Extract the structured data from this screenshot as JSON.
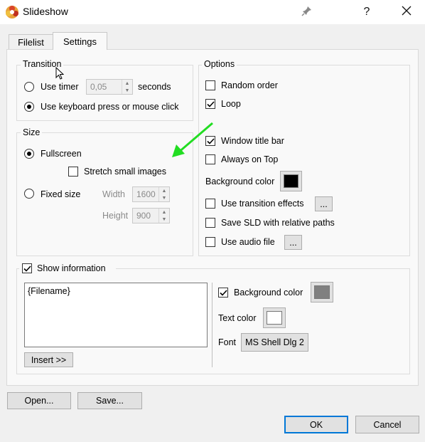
{
  "window": {
    "title": "Slideshow",
    "pin_icon": "pin-icon",
    "help_label": "?",
    "close_icon": "close-icon",
    "app_icon": "flower-logo-icon"
  },
  "tabs": [
    {
      "label": "Filelist"
    },
    {
      "label": "Settings"
    }
  ],
  "transition": {
    "legend": "Transition",
    "use_timer_label": "Use timer",
    "timer_value": "0,05",
    "seconds_label": "seconds",
    "keyboard_label": "Use keyboard press or mouse click",
    "selected": "keyboard"
  },
  "size": {
    "legend": "Size",
    "fullscreen_label": "Fullscreen",
    "stretch_label": "Stretch small images",
    "fixed_label": "Fixed size",
    "width_label": "Width",
    "width_value": "1600",
    "height_label": "Height",
    "height_value": "900",
    "selected": "fullscreen"
  },
  "options": {
    "legend": "Options",
    "random_order": "Random order",
    "loop": "Loop",
    "window_title_bar": "Window title bar",
    "always_on_top": "Always on Top",
    "background_color_label": "Background color",
    "background_color": "#000000",
    "use_transition_effects": "Use transition effects",
    "save_sld": "Save SLD with relative paths",
    "use_audio_file": "Use audio file",
    "ellipsis": "..."
  },
  "show_information": {
    "label": "Show information",
    "text": "{Filename}",
    "insert_label": "Insert >>",
    "background_color_label": "Background color",
    "background_color": "#808080",
    "text_color_label": "Text color",
    "text_color": "#ffffff",
    "font_label": "Font",
    "font_value": "MS Shell Dlg 2"
  },
  "footer": {
    "open_label": "Open...",
    "save_label": "Save...",
    "ok_label": "OK",
    "cancel_label": "Cancel"
  },
  "colors": {
    "accent": "#0078d7",
    "annotation_arrow": "#22dd22"
  }
}
